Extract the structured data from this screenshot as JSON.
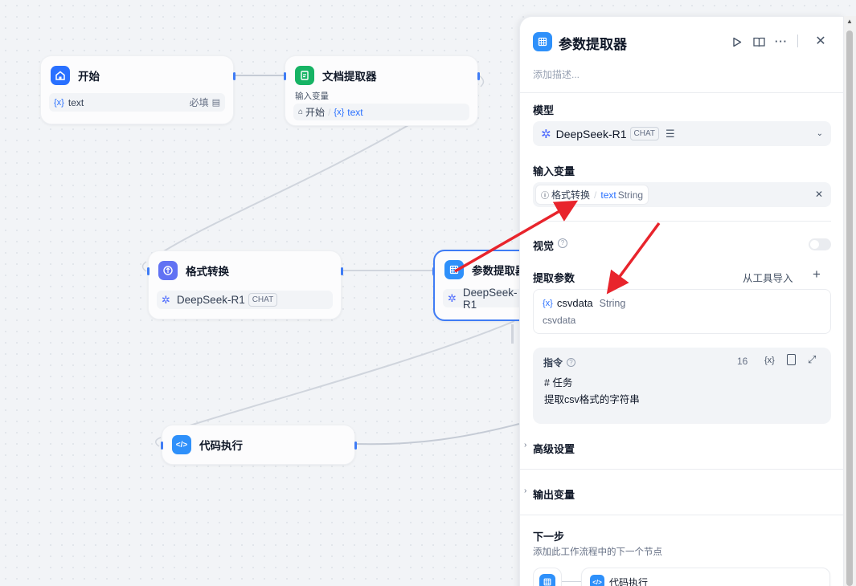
{
  "nodes": {
    "start": {
      "title": "开始",
      "var_prefix": "{x}",
      "var_name": "text",
      "required": "必填"
    },
    "doc_extractor": {
      "title": "文档提取器",
      "input_label": "输入变量",
      "source_node": "开始",
      "var_prefix": "{x}",
      "var_name": "text"
    },
    "format_convert": {
      "title": "格式转换",
      "model": "DeepSeek-R1",
      "mode": "CHAT"
    },
    "param_extractor": {
      "title": "参数提取器",
      "model": "DeepSeek-R1"
    },
    "code_exec": {
      "title": "代码执行"
    }
  },
  "panel": {
    "title": "参数提取器",
    "description_placeholder": "添加描述...",
    "model_label": "模型",
    "model_name": "DeepSeek-R1",
    "model_mode": "CHAT",
    "input_label": "输入变量",
    "input_source": "格式转换",
    "input_var": "text",
    "input_type": "String",
    "vision_label": "视觉",
    "vision_enabled": false,
    "extract_label": "提取参数",
    "import_from_tool": "从工具导入",
    "param_prefix": "{x}",
    "param_name": "csvdata",
    "param_type": "String",
    "param_desc": "csvdata",
    "instruction_label": "指令",
    "instruction_count": "16",
    "instruction_var_btn": "{x}",
    "instruction_line1": "# 任务",
    "instruction_line2": "提取csv格式的字符串",
    "advanced_label": "高级设置",
    "output_label": "输出变量",
    "next_label": "下一步",
    "next_desc": "添加此工作流程中的下一个节点",
    "next_node": "代码执行"
  },
  "colors": {
    "accent": "#2970ff",
    "start_icon": "#2970ff",
    "doc_icon": "#16b364",
    "format_icon": "#6172f3",
    "param_icon": "#2e90fa",
    "code_icon": "#2e90fa",
    "annotation_arrow": "#e8242c"
  }
}
